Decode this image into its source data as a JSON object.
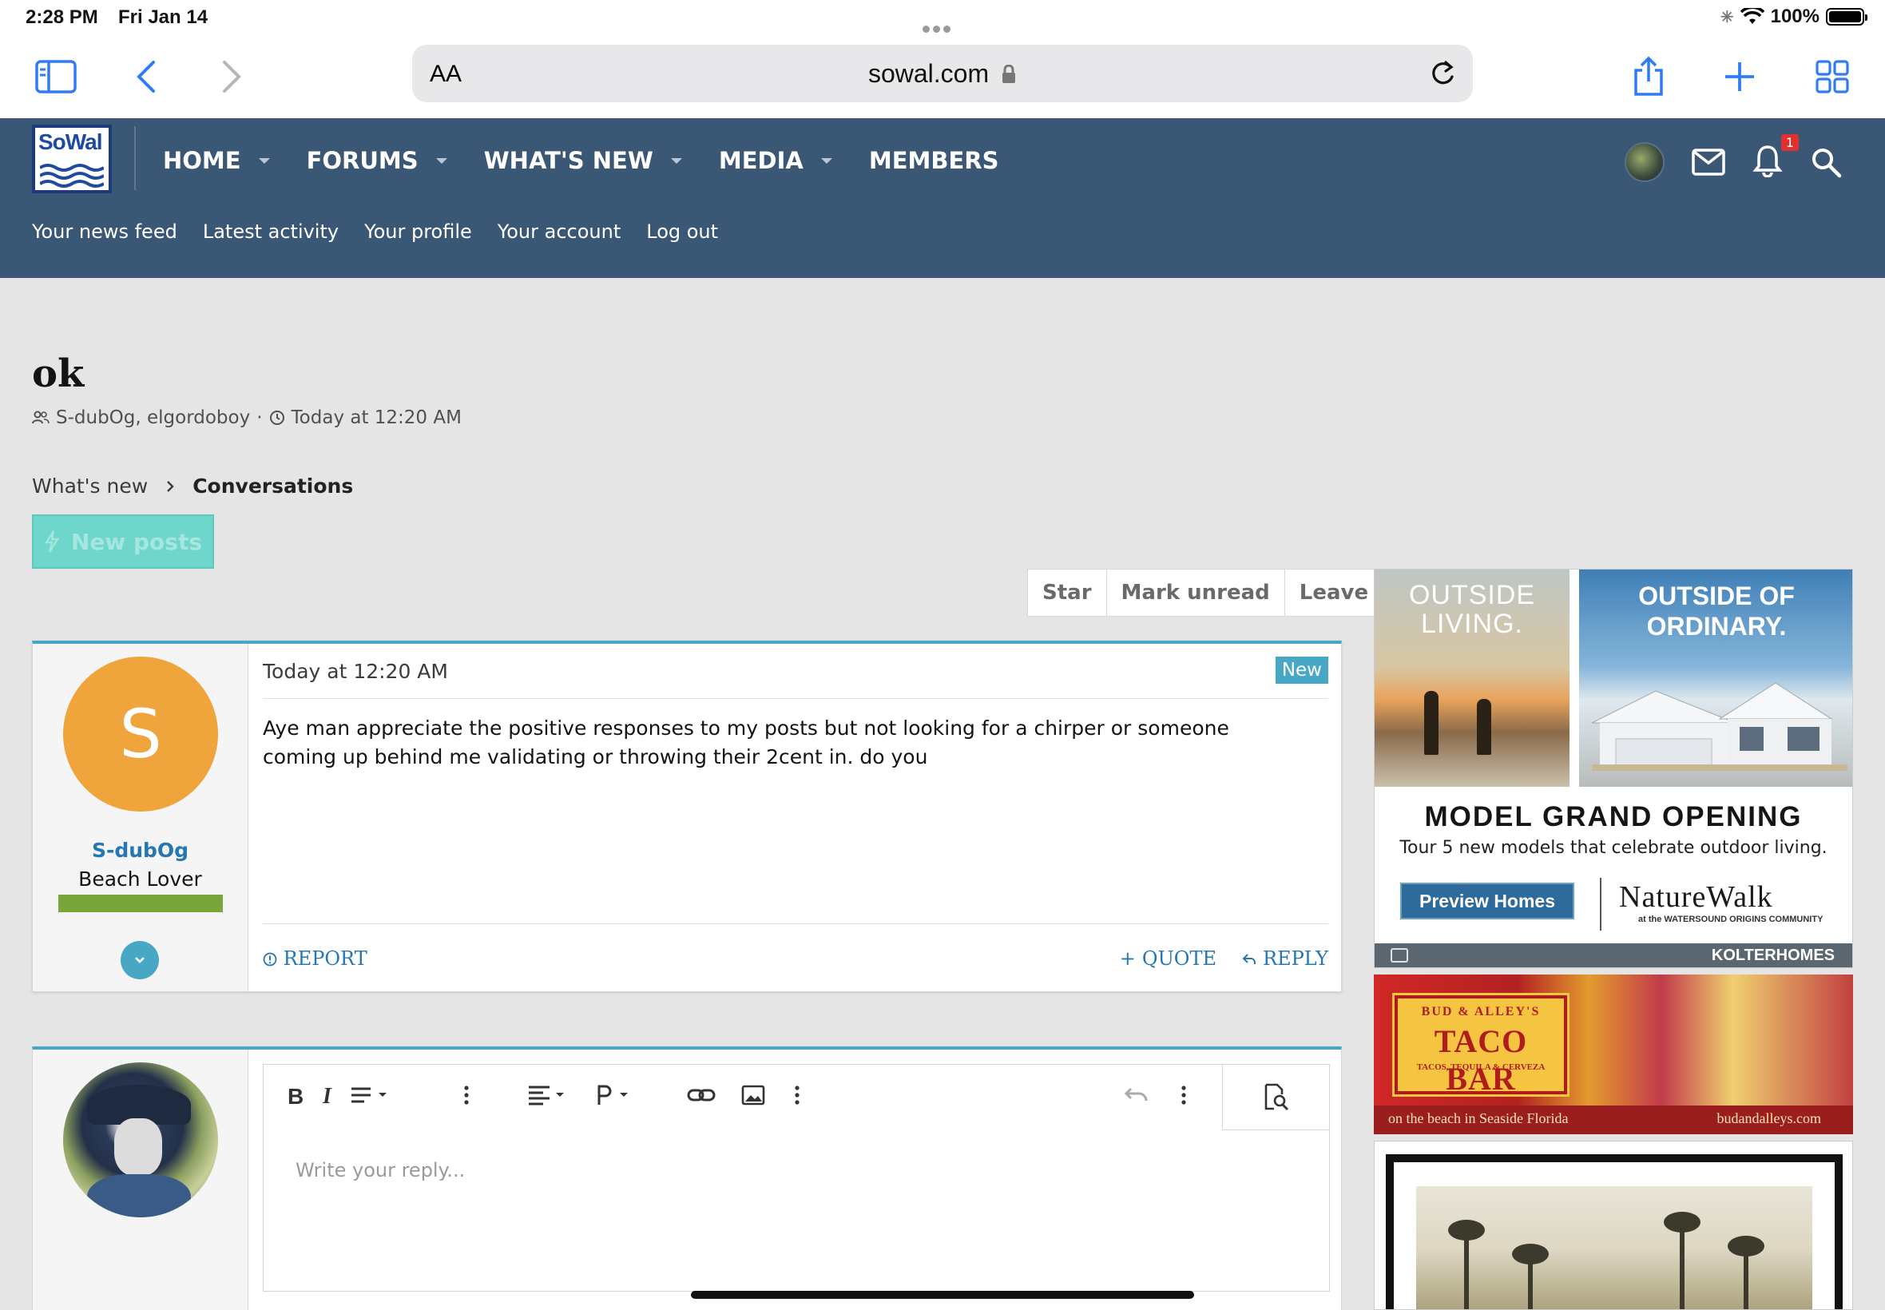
{
  "status_bar": {
    "time": "2:28 PM",
    "date": "Fri Jan 14",
    "battery": "100%"
  },
  "browser": {
    "aa_label": "AA",
    "host": "sowal.com"
  },
  "site": {
    "logo_text": "SoWal",
    "nav": [
      {
        "label": "HOME",
        "has_menu": true
      },
      {
        "label": "FORUMS",
        "has_menu": true
      },
      {
        "label": "WHAT'S NEW",
        "has_menu": true
      },
      {
        "label": "MEDIA",
        "has_menu": true
      },
      {
        "label": "MEMBERS",
        "has_menu": false
      }
    ],
    "alert_count": "1",
    "subnav": [
      "Your news feed",
      "Latest activity",
      "Your profile",
      "Your account",
      "Log out"
    ]
  },
  "conversation": {
    "title": "ok",
    "participants": "S-dubOg, elgordoboy",
    "separator": "·",
    "started": "Today at 12:20 AM",
    "breadcrumb": [
      "What's new",
      "Conversations"
    ],
    "new_posts_label": "New posts",
    "actions": [
      "Star",
      "Mark unread",
      "Leave"
    ]
  },
  "message": {
    "avatar_letter": "S",
    "username": "S-dubOg",
    "user_title": "Beach Lover",
    "date": "Today at 12:20 AM",
    "badge": "New",
    "text": "Aye man appreciate the positive responses to my posts but not looking for a chirper or someone coming up behind me validating or throwing their 2cent in. do you",
    "report": "REPORT",
    "quote": "QUOTE",
    "reply": "REPLY"
  },
  "reply_editor": {
    "placeholder": "Write your reply..."
  },
  "ads": {
    "ad1": {
      "left_headline": "OUTSIDE LIVING.",
      "right_headline": "OUTSIDE OF ORDINARY.",
      "headline": "MODEL GRAND OPENING",
      "sub": "Tour 5 new models that celebrate outdoor living.",
      "cta": "Preview Homes",
      "brand": "NatureWalk",
      "brand_sub": "at the WATERSOUND ORIGINS COMMUNITY",
      "builder": "KOLTERHOMES"
    },
    "ad2": {
      "sign_top": "BUD & ALLEY'S",
      "sign_main": "TACO BAR",
      "sign_sub": "TACOS, TEQUILA & CERVEZA",
      "caption_left": "on the beach in Seaside Florida",
      "caption_right": "budandalleys.com"
    }
  },
  "colors": {
    "header_bg": "#3a5775",
    "accent": "#47a7c4",
    "link": "#2577b1",
    "new_posts_bg": "#6fd6cc",
    "avatar_bg": "#f0a53c",
    "user_banner": "#7aa53a",
    "page_bg": "#e5e5e5"
  }
}
